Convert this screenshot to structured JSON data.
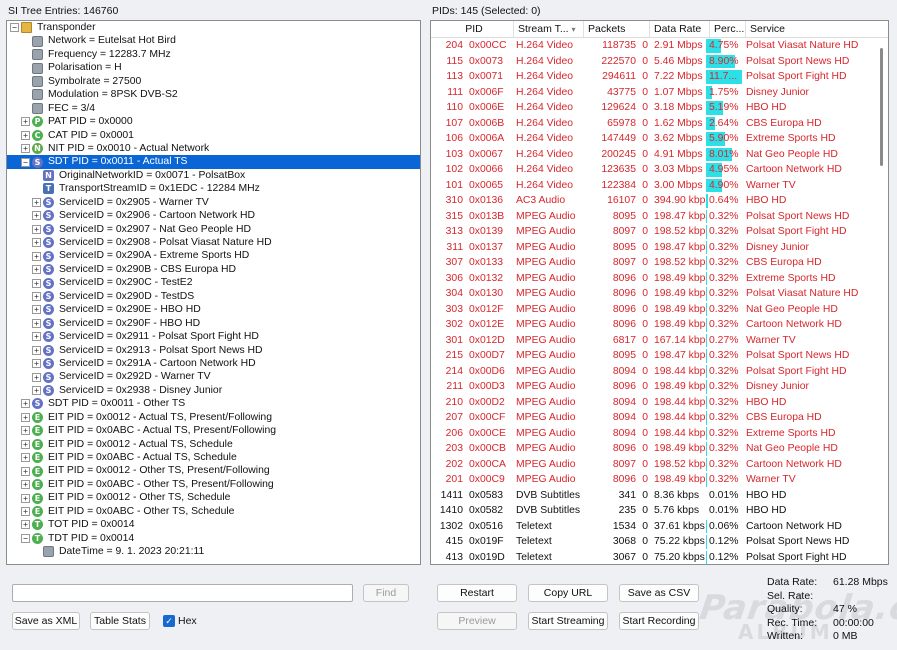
{
  "tree_header": "SI Tree Entries: 146760",
  "grid_header": "PIDs: 145   (Selected: 0)",
  "tree": [
    {
      "d": 0,
      "exp": "-",
      "icon": "folder",
      "t": "Transponder"
    },
    {
      "d": 1,
      "exp": "",
      "icon": "leaf",
      "t": "Network = Eutelsat Hot Bird"
    },
    {
      "d": 1,
      "exp": "",
      "icon": "leaf",
      "t": "Frequency = 12283.7 MHz"
    },
    {
      "d": 1,
      "exp": "",
      "icon": "leaf",
      "t": "Polarisation = H"
    },
    {
      "d": 1,
      "exp": "",
      "icon": "leaf",
      "t": "Symbolrate = 27500"
    },
    {
      "d": 1,
      "exp": "",
      "icon": "leaf",
      "t": "Modulation = 8PSK DVB-S2"
    },
    {
      "d": 1,
      "exp": "",
      "icon": "leaf",
      "t": "FEC = 3/4"
    },
    {
      "d": 1,
      "exp": "+",
      "icon": "P",
      "t": "PAT PID = 0x0000"
    },
    {
      "d": 1,
      "exp": "+",
      "icon": "C",
      "t": "CAT PID = 0x0001"
    },
    {
      "d": 1,
      "exp": "+",
      "icon": "N",
      "t": "NIT PID = 0x0010 - Actual Network"
    },
    {
      "d": 1,
      "exp": "-",
      "icon": "S",
      "t": "SDT PID = 0x0011 - Actual TS",
      "sel": true
    },
    {
      "d": 2,
      "exp": "",
      "icon": "n",
      "t": "OriginalNetworkID = 0x0071 - PolsatBox"
    },
    {
      "d": 2,
      "exp": "",
      "icon": "t",
      "t": "TransportStreamID = 0x1EDC - 12284 MHz"
    },
    {
      "d": 2,
      "exp": "+",
      "icon": "S",
      "t": "ServiceID = 0x2905 - Warner TV"
    },
    {
      "d": 2,
      "exp": "+",
      "icon": "S",
      "t": "ServiceID = 0x2906 - Cartoon Network HD"
    },
    {
      "d": 2,
      "exp": "+",
      "icon": "S",
      "t": "ServiceID = 0x2907 - Nat Geo People HD"
    },
    {
      "d": 2,
      "exp": "+",
      "icon": "S",
      "t": "ServiceID = 0x2908 - Polsat Viasat Nature HD"
    },
    {
      "d": 2,
      "exp": "+",
      "icon": "S",
      "t": "ServiceID = 0x290A - Extreme Sports HD"
    },
    {
      "d": 2,
      "exp": "+",
      "icon": "S",
      "t": "ServiceID = 0x290B - CBS Europa HD"
    },
    {
      "d": 2,
      "exp": "+",
      "icon": "S",
      "t": "ServiceID = 0x290C - TestE2"
    },
    {
      "d": 2,
      "exp": "+",
      "icon": "S",
      "t": "ServiceID = 0x290D - TestDS"
    },
    {
      "d": 2,
      "exp": "+",
      "icon": "S",
      "t": "ServiceID = 0x290E - HBO HD"
    },
    {
      "d": 2,
      "exp": "+",
      "icon": "S",
      "t": "ServiceID = 0x290F - HBO HD"
    },
    {
      "d": 2,
      "exp": "+",
      "icon": "S",
      "t": "ServiceID = 0x2911 - Polsat Sport Fight HD"
    },
    {
      "d": 2,
      "exp": "+",
      "icon": "S",
      "t": "ServiceID = 0x2913 - Polsat Sport News HD"
    },
    {
      "d": 2,
      "exp": "+",
      "icon": "S",
      "t": "ServiceID = 0x291A - Cartoon Network HD"
    },
    {
      "d": 2,
      "exp": "+",
      "icon": "S",
      "t": "ServiceID = 0x292D - Warner TV"
    },
    {
      "d": 2,
      "exp": "+",
      "icon": "S",
      "t": "ServiceID = 0x2938 - Disney Junior"
    },
    {
      "d": 1,
      "exp": "+",
      "icon": "S",
      "t": "SDT PID = 0x0011 - Other TS"
    },
    {
      "d": 1,
      "exp": "+",
      "icon": "E",
      "t": "EIT PID = 0x0012 - Actual TS, Present/Following"
    },
    {
      "d": 1,
      "exp": "+",
      "icon": "E",
      "t": "EIT PID = 0x0ABC - Actual TS, Present/Following"
    },
    {
      "d": 1,
      "exp": "+",
      "icon": "E",
      "t": "EIT PID = 0x0012 - Actual TS, Schedule"
    },
    {
      "d": 1,
      "exp": "+",
      "icon": "E",
      "t": "EIT PID = 0x0ABC - Actual TS, Schedule"
    },
    {
      "d": 1,
      "exp": "+",
      "icon": "E",
      "t": "EIT PID = 0x0012 - Other TS, Present/Following"
    },
    {
      "d": 1,
      "exp": "+",
      "icon": "E",
      "t": "EIT PID = 0x0ABC - Other TS, Present/Following"
    },
    {
      "d": 1,
      "exp": "+",
      "icon": "E",
      "t": "EIT PID = 0x0012 - Other TS, Schedule"
    },
    {
      "d": 1,
      "exp": "+",
      "icon": "E",
      "t": "EIT PID = 0x0ABC - Other TS, Schedule"
    },
    {
      "d": 1,
      "exp": "+",
      "icon": "T",
      "t": "TOT PID = 0x0014"
    },
    {
      "d": 1,
      "exp": "-",
      "icon": "T",
      "t": "TDT PID = 0x0014"
    },
    {
      "d": 2,
      "exp": "",
      "icon": "leaf",
      "t": "DateTime = 9. 1. 2023 20:21:11"
    }
  ],
  "columns": [
    "PID",
    "Stream T...",
    "Packets",
    "Data Rate",
    "Perc...",
    "Service"
  ],
  "rows": [
    [
      "204",
      "0x00CC",
      "H.264 Video",
      "118735",
      "0",
      "2.91 Mbps",
      "4.75%",
      "Polsat Viasat Nature HD",
      4.75,
      1
    ],
    [
      "115",
      "0x0073",
      "H.264 Video",
      "222570",
      "0",
      "5.46 Mbps",
      "8.90%",
      "Polsat Sport News HD",
      8.9,
      1
    ],
    [
      "113",
      "0x0071",
      "H.264 Video",
      "294611",
      "0",
      "7.22 Mbps",
      "11.7...",
      "Polsat Sport Fight HD",
      11.78,
      1
    ],
    [
      "111",
      "0x006F",
      "H.264 Video",
      "43775",
      "0",
      "1.07 Mbps",
      "1.75%",
      "Disney Junior",
      1.75,
      1
    ],
    [
      "110",
      "0x006E",
      "H.264 Video",
      "129624",
      "0",
      "3.18 Mbps",
      "5.19%",
      "HBO HD",
      5.19,
      1
    ],
    [
      "107",
      "0x006B",
      "H.264 Video",
      "65978",
      "0",
      "1.62 Mbps",
      "2.64%",
      "CBS Europa HD",
      2.64,
      1
    ],
    [
      "106",
      "0x006A",
      "H.264 Video",
      "147449",
      "0",
      "3.62 Mbps",
      "5.90%",
      "Extreme Sports HD",
      5.9,
      1
    ],
    [
      "103",
      "0x0067",
      "H.264 Video",
      "200245",
      "0",
      "4.91 Mbps",
      "8.01%",
      "Nat Geo People HD",
      8.01,
      1
    ],
    [
      "102",
      "0x0066",
      "H.264 Video",
      "123635",
      "0",
      "3.03 Mbps",
      "4.95%",
      "Cartoon Network HD",
      4.95,
      1
    ],
    [
      "101",
      "0x0065",
      "H.264 Video",
      "122384",
      "0",
      "3.00 Mbps",
      "4.90%",
      "Warner TV",
      4.9,
      1
    ],
    [
      "310",
      "0x0136",
      "AC3 Audio",
      "16107",
      "0",
      "394.90 kbps",
      "0.64%",
      "HBO HD",
      0.64,
      1
    ],
    [
      "315",
      "0x013B",
      "MPEG Audio",
      "8095",
      "0",
      "198.47 kbps",
      "0.32%",
      "Polsat Sport News HD",
      0.32,
      1
    ],
    [
      "313",
      "0x0139",
      "MPEG Audio",
      "8097",
      "0",
      "198.52 kbps",
      "0.32%",
      "Polsat Sport Fight HD",
      0.32,
      1
    ],
    [
      "311",
      "0x0137",
      "MPEG Audio",
      "8095",
      "0",
      "198.47 kbps",
      "0.32%",
      "Disney Junior",
      0.32,
      1
    ],
    [
      "307",
      "0x0133",
      "MPEG Audio",
      "8097",
      "0",
      "198.52 kbps",
      "0.32%",
      "CBS Europa HD",
      0.32,
      1
    ],
    [
      "306",
      "0x0132",
      "MPEG Audio",
      "8096",
      "0",
      "198.49 kbps",
      "0.32%",
      "Extreme Sports HD",
      0.32,
      1
    ],
    [
      "304",
      "0x0130",
      "MPEG Audio",
      "8096",
      "0",
      "198.49 kbps",
      "0.32%",
      "Polsat Viasat Nature HD",
      0.32,
      1
    ],
    [
      "303",
      "0x012F",
      "MPEG Audio",
      "8096",
      "0",
      "198.49 kbps",
      "0.32%",
      "Nat Geo People HD",
      0.32,
      1
    ],
    [
      "302",
      "0x012E",
      "MPEG Audio",
      "8096",
      "0",
      "198.49 kbps",
      "0.32%",
      "Cartoon Network HD",
      0.32,
      1
    ],
    [
      "301",
      "0x012D",
      "MPEG Audio",
      "6817",
      "0",
      "167.14 kbps",
      "0.27%",
      "Warner TV",
      0.27,
      1
    ],
    [
      "215",
      "0x00D7",
      "MPEG Audio",
      "8095",
      "0",
      "198.47 kbps",
      "0.32%",
      "Polsat Sport News HD",
      0.32,
      1
    ],
    [
      "214",
      "0x00D6",
      "MPEG Audio",
      "8094",
      "0",
      "198.44 kbps",
      "0.32%",
      "Polsat Sport Fight HD",
      0.32,
      1
    ],
    [
      "211",
      "0x00D3",
      "MPEG Audio",
      "8096",
      "0",
      "198.49 kbps",
      "0.32%",
      "Disney Junior",
      0.32,
      1
    ],
    [
      "210",
      "0x00D2",
      "MPEG Audio",
      "8094",
      "0",
      "198.44 kbps",
      "0.32%",
      "HBO HD",
      0.32,
      1
    ],
    [
      "207",
      "0x00CF",
      "MPEG Audio",
      "8094",
      "0",
      "198.44 kbps",
      "0.32%",
      "CBS Europa HD",
      0.32,
      1
    ],
    [
      "206",
      "0x00CE",
      "MPEG Audio",
      "8094",
      "0",
      "198.44 kbps",
      "0.32%",
      "Extreme Sports HD",
      0.32,
      1
    ],
    [
      "203",
      "0x00CB",
      "MPEG Audio",
      "8096",
      "0",
      "198.49 kbps",
      "0.32%",
      "Nat Geo People HD",
      0.32,
      1
    ],
    [
      "202",
      "0x00CA",
      "MPEG Audio",
      "8097",
      "0",
      "198.52 kbps",
      "0.32%",
      "Cartoon Network HD",
      0.32,
      1
    ],
    [
      "201",
      "0x00C9",
      "MPEG Audio",
      "8096",
      "0",
      "198.49 kbps",
      "0.32%",
      "Warner TV",
      0.32,
      1
    ],
    [
      "1411",
      "0x0583",
      "DVB Subtitles",
      "341",
      "0",
      "8.36 kbps",
      "0.01%",
      "HBO HD",
      0.01,
      0
    ],
    [
      "1410",
      "0x0582",
      "DVB Subtitles",
      "235",
      "0",
      "5.76 kbps",
      "0.01%",
      "HBO HD",
      0.01,
      0
    ],
    [
      "1302",
      "0x0516",
      "Teletext",
      "1534",
      "0",
      "37.61 kbps",
      "0.06%",
      "Cartoon Network HD",
      0.06,
      0
    ],
    [
      "415",
      "0x019F",
      "Teletext",
      "3068",
      "0",
      "75.22 kbps",
      "0.12%",
      "Polsat Sport News HD",
      0.12,
      0
    ],
    [
      "413",
      "0x019D",
      "Teletext",
      "3067",
      "0",
      "75.20 kbps",
      "0.12%",
      "Polsat Sport Fight HD",
      0.12,
      0
    ]
  ],
  "buttons": {
    "find": "Find",
    "save_xml": "Save as XML",
    "table_stats": "Table Stats",
    "hex": "Hex",
    "restart": "Restart",
    "copy_url": "Copy URL",
    "save_csv": "Save as CSV",
    "preview": "Preview",
    "start_streaming": "Start Streaming",
    "start_recording": "Start Recording"
  },
  "search": {
    "value": ""
  },
  "stats": {
    "data_rate_label": "Data Rate:",
    "data_rate": "61.28 Mbps",
    "sel_rate_label": "Sel. Rate:",
    "sel_rate": "",
    "quality_label": "Quality:",
    "quality": "47 %",
    "rec_time_label": "Rec. Time:",
    "rec_time": "00:00:00",
    "written_label": "Written:",
    "written": "0 MB"
  },
  "watermark": {
    "line1": "Parabola.cz",
    "line2": "ALBUM"
  },
  "colors": {
    "red": "#d8262c",
    "bar": "#2ce0e8",
    "selection": "#0a66d6"
  }
}
